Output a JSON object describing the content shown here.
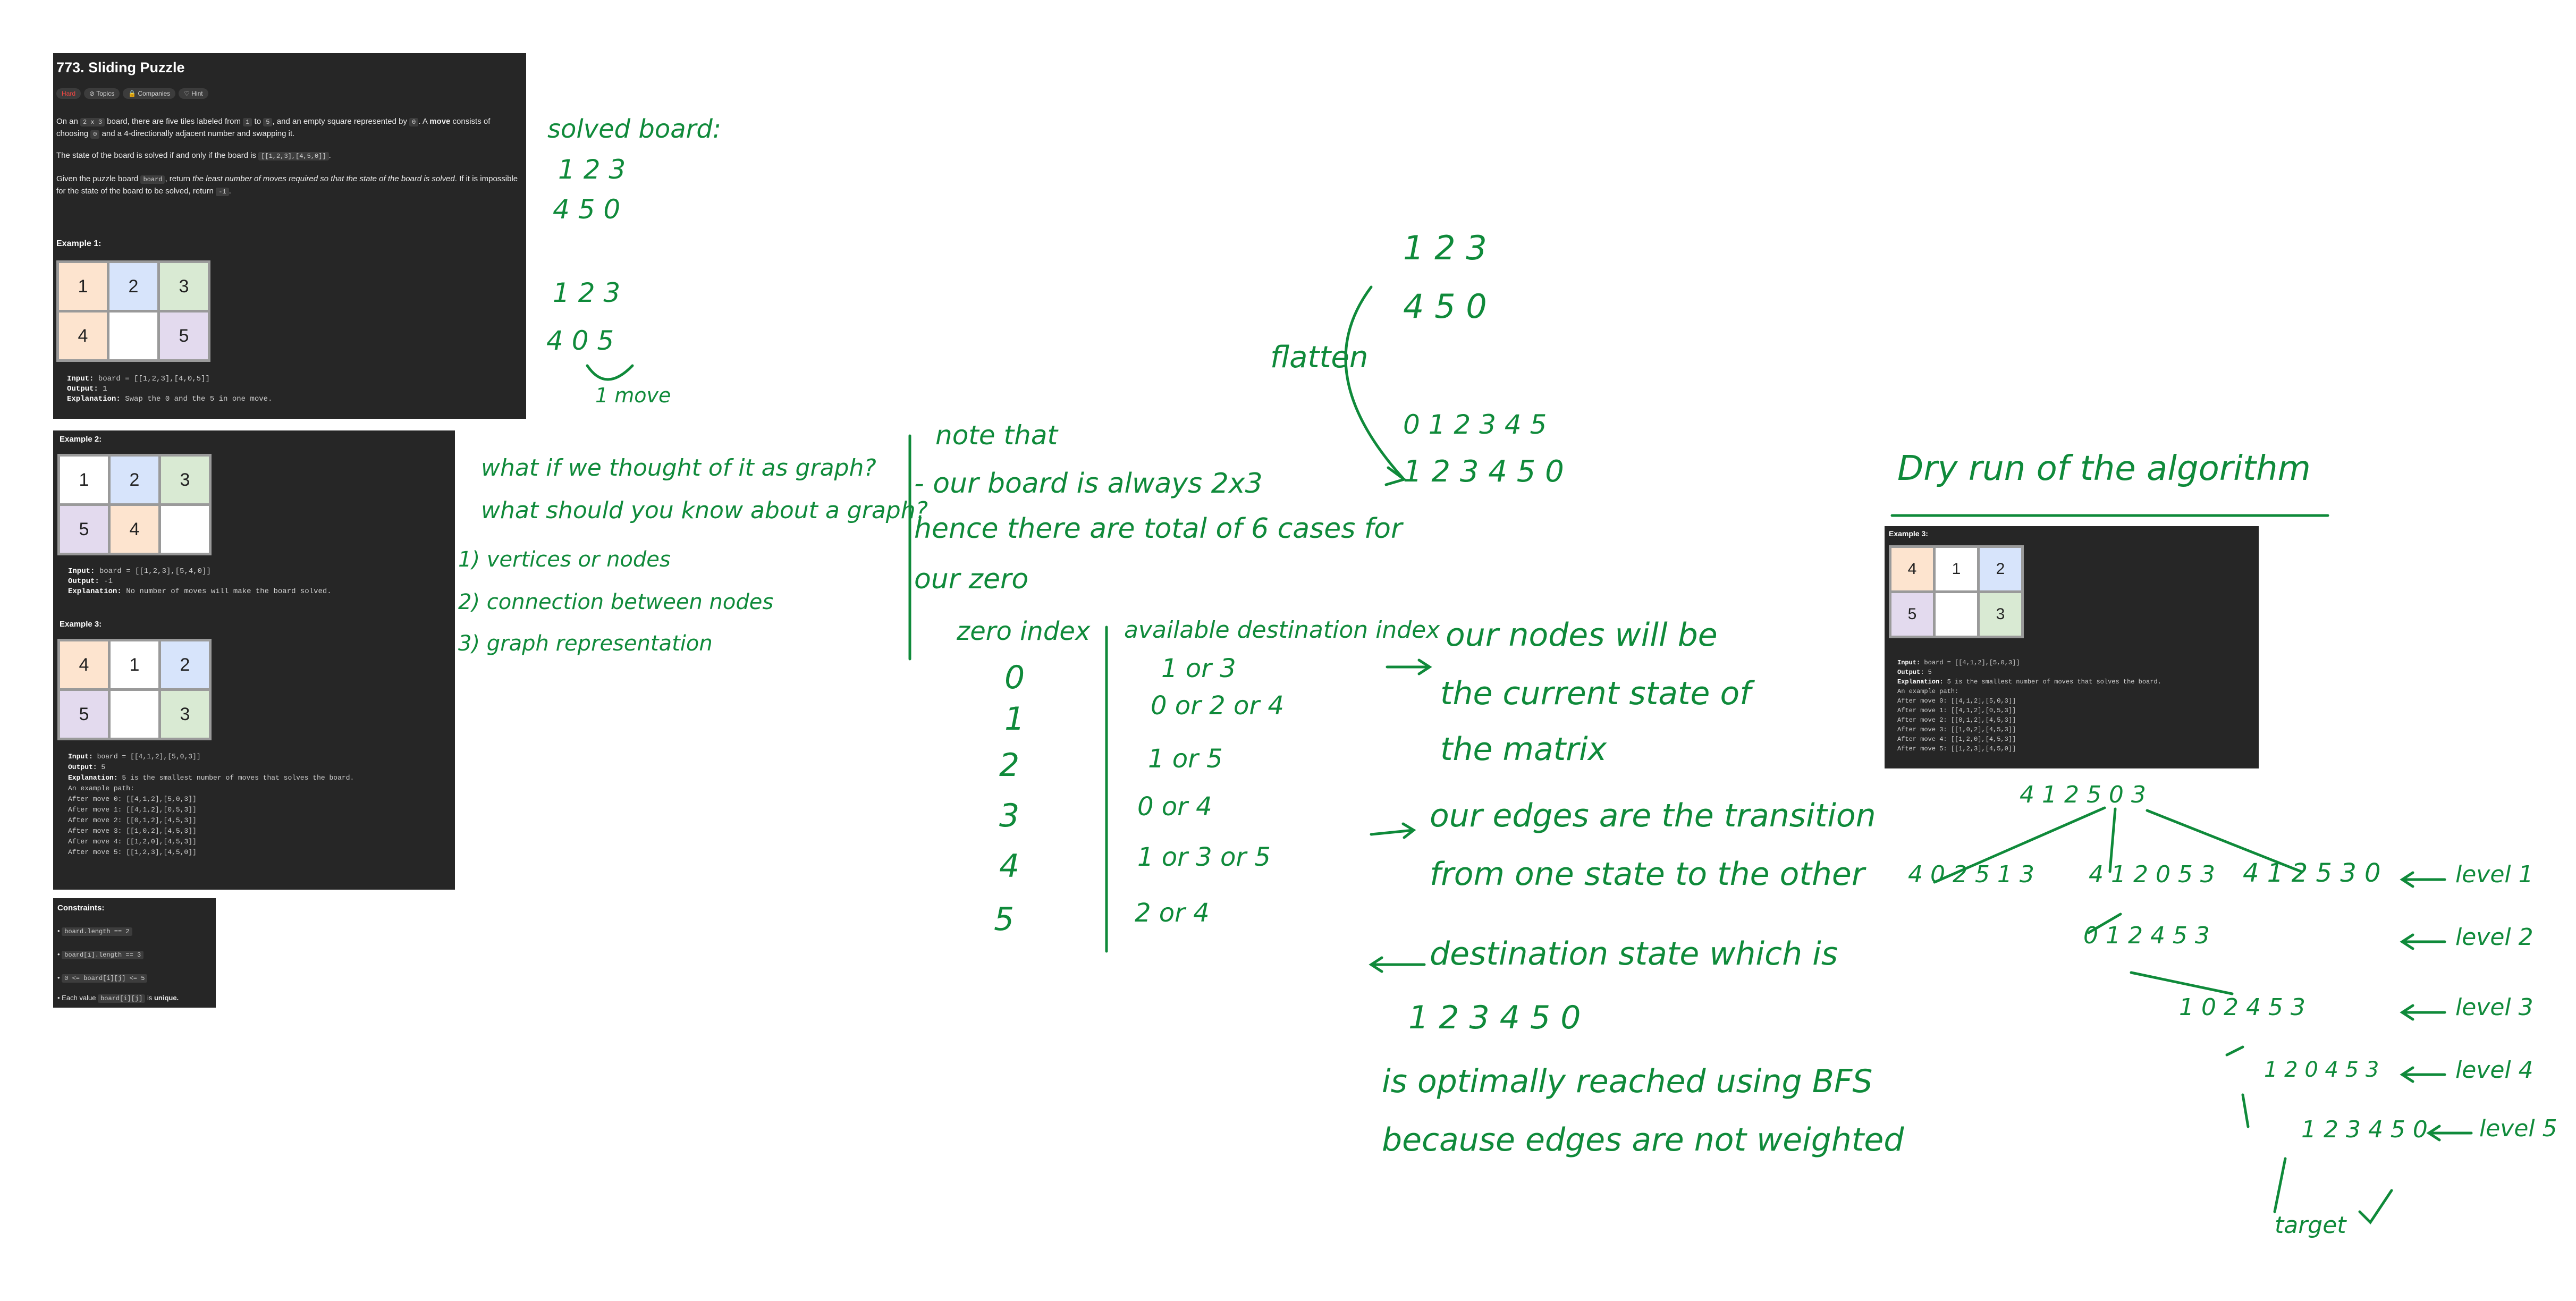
{
  "problem": {
    "title": "773. Sliding Puzzle",
    "tags": [
      "Hard",
      "Topics",
      "Companies",
      "Hint"
    ],
    "p1_a": "On an ",
    "p1_code1": "2 x 3",
    "p1_b": " board, there are five tiles labeled from ",
    "p1_code2": "1",
    "p1_c": " to ",
    "p1_code3": "5",
    "p1_d": ", and an empty square represented by ",
    "p1_code4": "0",
    "p1_e": ". A ",
    "p1_bold": "move",
    "p1_f": " consists of choosing ",
    "p1_code5": "0",
    "p1_g": " and a 4-directionally adjacent number and swapping it.",
    "p2_a": "The state of the board is solved if and only if the board is ",
    "p2_code": "[[1,2,3],[4,5,0]]",
    "p2_b": ".",
    "p3_a": "Given the puzzle board ",
    "p3_code1": "board",
    "p3_b": ", return ",
    "p3_em": "the least number of moves required so that the state of the board is solved",
    "p3_c": ". If it is impossible for the state of the board to be solved, return ",
    "p3_code2": "-1",
    "p3_d": "."
  },
  "example1": {
    "label": "Example 1:",
    "tiles": [
      "1",
      "2",
      "3",
      "4",
      "",
      "5"
    ],
    "input_label": "Input:",
    "input": " board = [[1,2,3],[4,0,5]]",
    "output_label": "Output:",
    "output": " 1",
    "expl_label": "Explanation:",
    "expl": " Swap the 0 and the 5 in one move."
  },
  "example2": {
    "label": "Example 2:",
    "tiles": [
      "1",
      "2",
      "3",
      "5",
      "4",
      ""
    ],
    "input_label": "Input:",
    "input": " board = [[1,2,3],[5,4,0]]",
    "output_label": "Output:",
    "output": " -1",
    "expl_label": "Explanation:",
    "expl": " No number of moves will make the board solved."
  },
  "example3": {
    "label": "Example 3:",
    "tiles": [
      "4",
      "1",
      "2",
      "5",
      "",
      "3"
    ],
    "input_label": "Input:",
    "input": " board = [[4,1,2],[5,0,3]]",
    "output_label": "Output:",
    "output": " 5",
    "expl_label": "Explanation:",
    "expl": " 5 is the smallest number of moves that solves the board.",
    "path": [
      "An example path:",
      "After move 0: [[4,1,2],[5,0,3]]",
      "After move 1: [[4,1,2],[0,5,3]]",
      "After move 2: [[0,1,2],[4,5,3]]",
      "After move 3: [[1,0,2],[4,5,3]]",
      "After move 4: [[1,2,0],[4,5,3]]",
      "After move 5: [[1,2,3],[4,5,0]]"
    ]
  },
  "constraints": {
    "label": "Constraints:",
    "items": [
      "board.length == 2",
      "board[i].length == 3",
      "0 <= board[i][j] <= 5"
    ],
    "last_code": "board[i][j]",
    "last_pre": "Each value ",
    "last_post": " is ",
    "last_bold": "unique."
  },
  "notes": {
    "solved_title": "solved board:",
    "solved_r1": "1  2  3",
    "solved_r2": "4  5  0",
    "ex1_r1": "1   2    3",
    "ex1_r2": "4   0    5",
    "one_move": "1 move",
    "graph_q1": "what if we thought of it as graph?",
    "graph_q2": "what should you know about a graph?",
    "graph_1": "1) vertices or nodes",
    "graph_2": "2) connection between nodes",
    "graph_3": "3) graph representation",
    "note_1": "note that",
    "note_2": "- our board is always 2x3",
    "note_3": "hence there are total of 6 cases for",
    "note_4": "our zero",
    "zero_header": "zero index",
    "dest_header": "available destination index",
    "zero_idx": [
      "0",
      "1",
      "2",
      "3",
      "4",
      "5"
    ],
    "dest_idx": [
      "1 or 3",
      "0 or 2 or 4",
      "1 or 5",
      "0 or 4",
      "1 or 3 or 5",
      "2 or 4"
    ],
    "flat_r1": "1   2   3",
    "flat_r2": "4   5   0",
    "flatten": "flatten",
    "flat_idx": "0  1   2    3  4  5",
    "flat_val": "1   2   3   4   5   0",
    "nodes_1": "our nodes will be",
    "nodes_2": "the current state of",
    "nodes_3": "the matrix",
    "edges_1": "our edges are the transition",
    "edges_2": "from one state to the other",
    "dest_1": "destination state which is",
    "dest_2": "1 2 3 4 5 0",
    "dest_3": "is optimally reached using BFS",
    "dest_4": "because edges are not weighted",
    "dry_title": "Dry run of the algorithm",
    "tree_root": "4 1 2 5 0 3",
    "tree_l1a": "4 0 2 5 1 3",
    "tree_l1b": "4 1 2 0 5 3",
    "tree_l1c": "4 1 2 5 3 0",
    "tree_l2": "0 1 2 4 5 3",
    "tree_l3": "1 0 2 4 5 3",
    "tree_l4": "1 2 0 4 5 3",
    "tree_l5": "1 2 3 4 5 0",
    "levels": [
      "level 1",
      "level 2",
      "level 3",
      "level 4",
      "level 5"
    ],
    "target": "target"
  },
  "snippet": {
    "label": "Example 3:",
    "tiles": [
      "4",
      "1",
      "2",
      "5",
      "",
      "3"
    ],
    "input_label": "Input:",
    "input": " board = [[4,1,2],[5,0,3]]",
    "output_label": "Output:",
    "output": " 5",
    "expl_label": "Explanation:",
    "expl": " 5 is the smallest number of moves that solves the board.",
    "path": [
      "An example path:",
      "After move 0: [[4,1,2],[5,0,3]]",
      "After move 1: [[4,1,2],[0,5,3]]",
      "After move 2: [[0,1,2],[4,5,3]]",
      "After move 3: [[1,0,2],[4,5,3]]",
      "After move 4: [[1,2,0],[4,5,3]]",
      "After move 5: [[1,2,3],[4,5,0]]"
    ]
  },
  "colors": {
    "orange": "#fde4cf",
    "blue": "#d7e4fb",
    "green": "#d9ead3",
    "purple": "#e3daee",
    "ink": "#0f8a3a"
  }
}
